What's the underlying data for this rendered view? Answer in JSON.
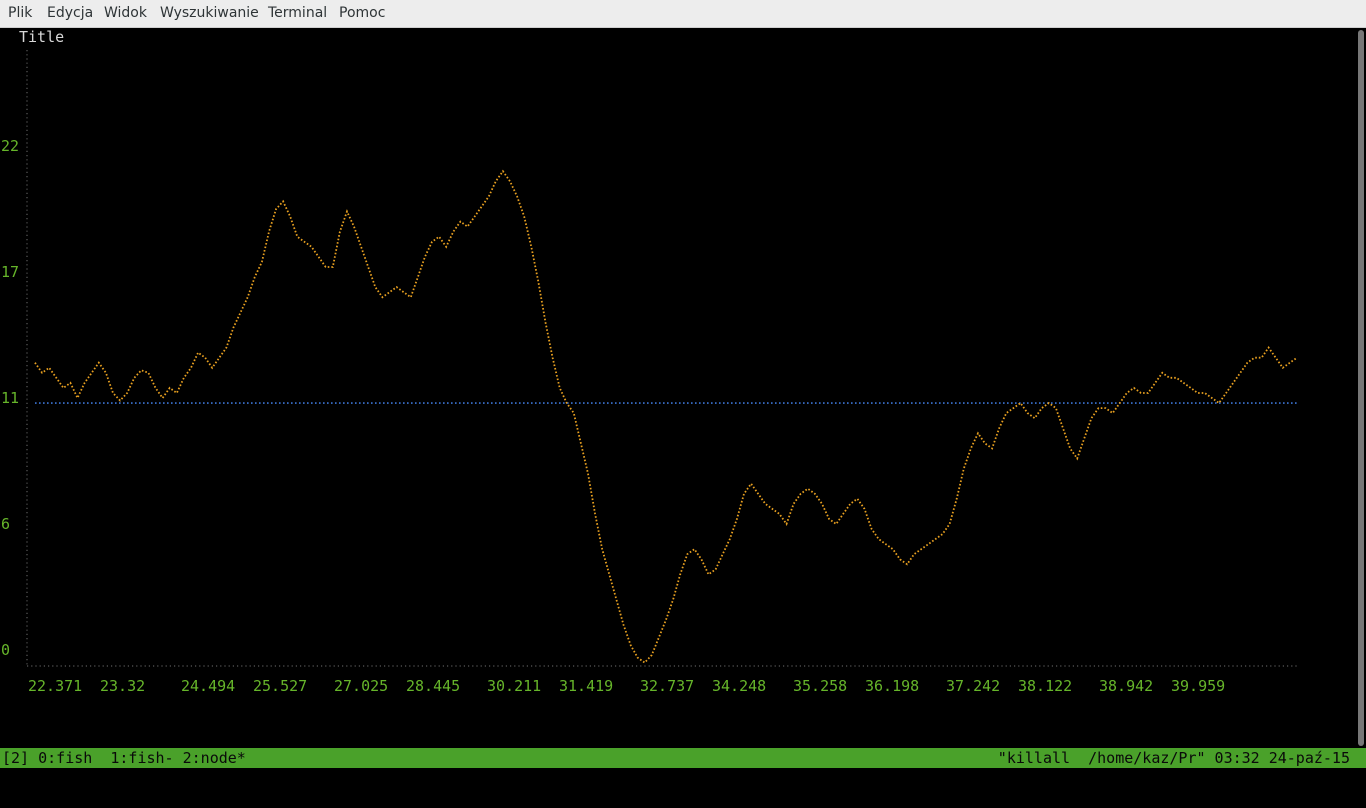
{
  "menu": {
    "items": [
      "Plik",
      "Edycja",
      "Widok",
      "Wyszukiwanie",
      "Terminal",
      "Pomoc"
    ]
  },
  "chart_data": {
    "type": "line",
    "title": "Title",
    "y_ticks": [
      "22",
      "17",
      "11",
      "6",
      "0"
    ],
    "y_tick_values": [
      22,
      17,
      11,
      6,
      0
    ],
    "x_ticks": [
      "22.371",
      "23.32",
      "24.494",
      "25.527",
      "27.025",
      "28.445",
      "30.211",
      "31.419",
      "32.737",
      "34.248",
      "35.258",
      "36.198",
      "37.242",
      "38.122",
      "38.942",
      "39.959"
    ],
    "ylim": [
      0,
      25
    ],
    "baseline": 9.8,
    "series_color": "#e8a020",
    "baseline_color": "#3c74d4",
    "grid": false,
    "series": [
      {
        "values": [
          11.4,
          11.0,
          11.2,
          10.8,
          10.4,
          10.6,
          10.0,
          10.6,
          11.0,
          11.4,
          11.0,
          10.2,
          9.9,
          10.2,
          10.8,
          11.1,
          11.0,
          10.4,
          10.0,
          10.4,
          10.2,
          10.8,
          11.2,
          11.8,
          11.6,
          11.2,
          11.6,
          12.0,
          12.8,
          13.4,
          14.0,
          14.8,
          15.4,
          16.6,
          17.5,
          17.8,
          17.2,
          16.4,
          16.2,
          16.0,
          15.6,
          15.2,
          15.2,
          16.6,
          17.4,
          16.8,
          16.0,
          15.2,
          14.4,
          14.0,
          14.2,
          14.4,
          14.2,
          14.0,
          14.8,
          15.6,
          16.2,
          16.4,
          16.0,
          16.6,
          17.0,
          16.8,
          17.2,
          17.6,
          18.0,
          18.6,
          19.0,
          18.6,
          18.0,
          17.2,
          16.0,
          14.6,
          13.0,
          11.6,
          10.4,
          9.8,
          9.4,
          8.2,
          7.0,
          5.4,
          4.0,
          3.0,
          2.0,
          1.0,
          0.2,
          -0.3,
          -0.5,
          -0.2,
          0.5,
          1.2,
          2.0,
          3.0,
          3.8,
          4.0,
          3.6,
          3.0,
          3.2,
          3.8,
          4.4,
          5.2,
          6.2,
          6.6,
          6.2,
          5.8,
          5.6,
          5.4,
          5.0,
          5.8,
          6.2,
          6.4,
          6.2,
          5.8,
          5.2,
          5.0,
          5.4,
          5.8,
          6.0,
          5.6,
          4.8,
          4.4,
          4.2,
          4.0,
          3.6,
          3.4,
          3.8,
          4.0,
          4.2,
          4.4,
          4.6,
          5.0,
          6.0,
          7.2,
          8.0,
          8.6,
          8.2,
          8.0,
          8.8,
          9.4,
          9.6,
          9.8,
          9.4,
          9.2,
          9.6,
          9.8,
          9.6,
          8.8,
          8.0,
          7.6,
          8.4,
          9.2,
          9.6,
          9.6,
          9.4,
          9.8,
          10.2,
          10.4,
          10.2,
          10.2,
          10.6,
          11.0,
          10.8,
          10.8,
          10.6,
          10.4,
          10.2,
          10.2,
          10.0,
          9.8,
          10.2,
          10.6,
          11.0,
          11.4,
          11.6,
          11.6,
          12.0,
          11.6,
          11.2,
          11.4,
          11.6
        ]
      }
    ]
  },
  "statusbar": {
    "left": "[2] 0:fish  1:fish- 2:node*",
    "right": "\"killall  /home/kaz/Pr\" 03:32 24-paź-15"
  }
}
